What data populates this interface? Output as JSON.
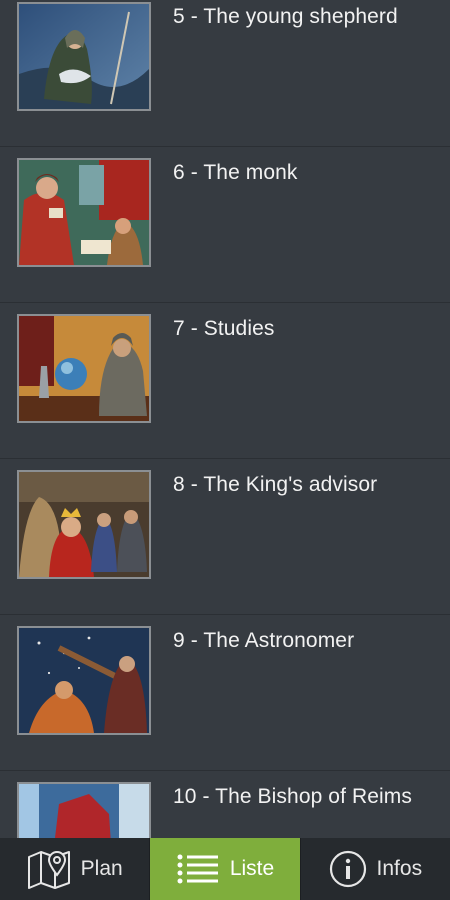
{
  "list": {
    "items": [
      {
        "label": "5 - The young shepherd"
      },
      {
        "label": "6 - The monk"
      },
      {
        "label": "7 - Studies"
      },
      {
        "label": "8 - The King's advisor"
      },
      {
        "label": "9 - The Astronomer"
      },
      {
        "label": "10 - The Bishop of Reims"
      }
    ]
  },
  "nav": {
    "plan_label": "Plan",
    "liste_label": "Liste",
    "infos_label": "Infos"
  },
  "colors": {
    "background": "#353a40",
    "active_tab": "#7fae3c",
    "nav_background": "#262a2e"
  }
}
